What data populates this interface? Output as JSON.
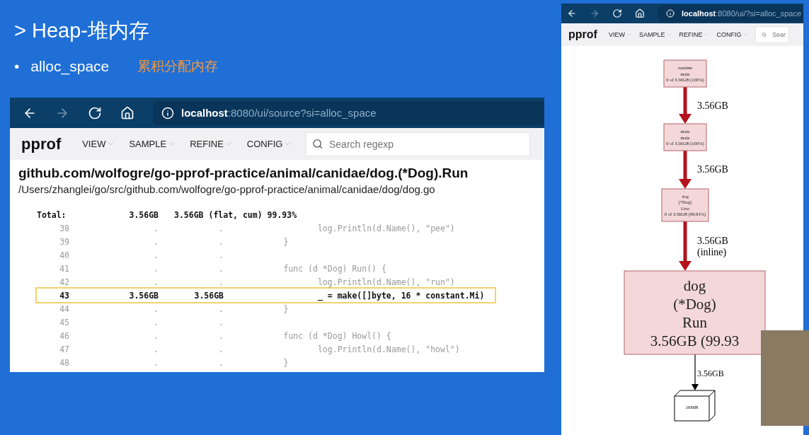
{
  "slide": {
    "title": "> Heap-堆内存",
    "bullet_mark": "•",
    "bullet": "alloc_space",
    "bullet_note": "累积分配内存"
  },
  "source_view": {
    "browser": {
      "host": "localhost",
      "path": ":8080/ui/source?si=alloc_space"
    },
    "toolbar": {
      "logo": "pprof",
      "menus": [
        "VIEW",
        "SAMPLE",
        "REFINE",
        "CONFIG"
      ],
      "search": {
        "placeholder": "Search regexp"
      }
    },
    "function_name": "github.com/wolfogre/go-pprof-practice/animal/canidae/dog.(*Dog).Run",
    "file_path": "/Users/zhanglei/go/src/github.com/wolfogre/go-pprof-practice/animal/canidae/dog/dog.go",
    "total": {
      "label": "Total:",
      "flat": "3.56GB",
      "cum": "3.56GB (flat, cum) 99.93%"
    },
    "lines": [
      {
        "line": "38",
        "flat": ".",
        "cum": ".",
        "code": "\t\tlog.Println(d.Name(), \"pee\")",
        "highlighted": false
      },
      {
        "line": "39",
        "flat": ".",
        "cum": ".",
        "code": "\t}",
        "highlighted": false
      },
      {
        "line": "40",
        "flat": ".",
        "cum": ".",
        "highlighted": false
      },
      {
        "line": "41",
        "flat": ".",
        "cum": ".",
        "code": "\tfunc (d *Dog) Run() {",
        "highlighted": false
      },
      {
        "line": "42",
        "flat": ".",
        "cum": ".",
        "code": "\t\tlog.Println(d.Name(), \"run\")",
        "highlighted": false
      },
      {
        "line": "43",
        "flat": "3.56GB",
        "cum": "3.56GB",
        "code": "\t\t_ = make([]byte, 16 * constant.Mi)",
        "highlighted": true
      },
      {
        "line": "44",
        "flat": ".",
        "cum": ".",
        "code": "\t}",
        "highlighted": false
      },
      {
        "line": "45",
        "flat": ".",
        "cum": ".",
        "highlighted": false
      },
      {
        "line": "46",
        "flat": ".",
        "cum": ".",
        "code": "\tfunc (d *Dog) Howl() {",
        "highlighted": false
      },
      {
        "line": "47",
        "flat": ".",
        "cum": ".",
        "code": "\t\tlog.Println(d.Name(), \"howl\")",
        "highlighted": false
      },
      {
        "line": "48",
        "flat": ".",
        "cum": ".",
        "code": "\t}",
        "highlighted": false
      }
    ]
  },
  "graph_view": {
    "browser": {
      "host": "localhost",
      "path": ":8080/ui/?si=alloc_space"
    },
    "toolbar": {
      "logo": "pprof",
      "menus": [
        "VIEW",
        "SAMPLE",
        "REFINE",
        "CONFIG"
      ],
      "search": {
        "placeholder": "Sear"
      }
    },
    "nodes": [
      {
        "kind": "small",
        "lines": [
          "runtime",
          "main",
          "0 of 3.56GB (100%)"
        ]
      },
      {
        "kind": "small",
        "lines": [
          "main",
          "main",
          "0 of 3.56GB (100%)"
        ]
      },
      {
        "kind": "small",
        "lines": [
          "dog",
          "(*Dog)",
          "Live",
          "0 of 3.56GB (99.93%)"
        ]
      },
      {
        "kind": "large",
        "lines": [
          "dog",
          "(*Dog)",
          "Run",
          "3.56GB (99.93"
        ]
      },
      {
        "kind": "box",
        "lines": [
          "16MB"
        ]
      }
    ],
    "edges": [
      {
        "kind": "thick",
        "labels": [
          "3.56GB"
        ]
      },
      {
        "kind": "thick",
        "labels": [
          "3.56GB"
        ]
      },
      {
        "kind": "thick",
        "labels": [
          "3.56GB",
          "(inline)"
        ]
      },
      {
        "kind": "thin",
        "labels": [
          "3.56GB"
        ]
      }
    ]
  }
}
